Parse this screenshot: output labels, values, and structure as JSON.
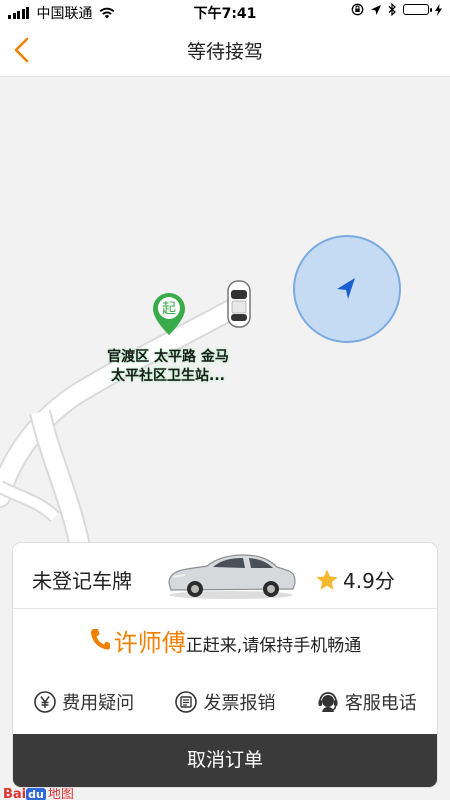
{
  "status_bar": {
    "carrier": "中国联通",
    "time": "下午7:41"
  },
  "nav": {
    "title": "等待接驾",
    "back_icon": "chevron-left-icon"
  },
  "map": {
    "start_marker_text": "起",
    "start_address_line1": "官渡区 太平路 金马",
    "start_address_line2": "太平社区卫生站..."
  },
  "driver_card": {
    "plate": "未登记车牌",
    "rating": "4.9分",
    "driver_name": "许师傅",
    "driver_status": "正赶来,请保持手机畅通",
    "actions": [
      {
        "label": "费用疑问",
        "icon": "yen-icon"
      },
      {
        "label": "发票报销",
        "icon": "invoice-icon"
      },
      {
        "label": "客服电话",
        "icon": "headset-icon"
      }
    ],
    "cancel_label": "取消订单"
  },
  "map_logo": {
    "bai": "Bai",
    "du": "du",
    "map_text": "地图"
  },
  "colors": {
    "accent_orange": "#f08000",
    "start_green": "#3aab4a",
    "star_yellow": "#f5b82e",
    "cancel_bg": "#3a3a3a"
  }
}
